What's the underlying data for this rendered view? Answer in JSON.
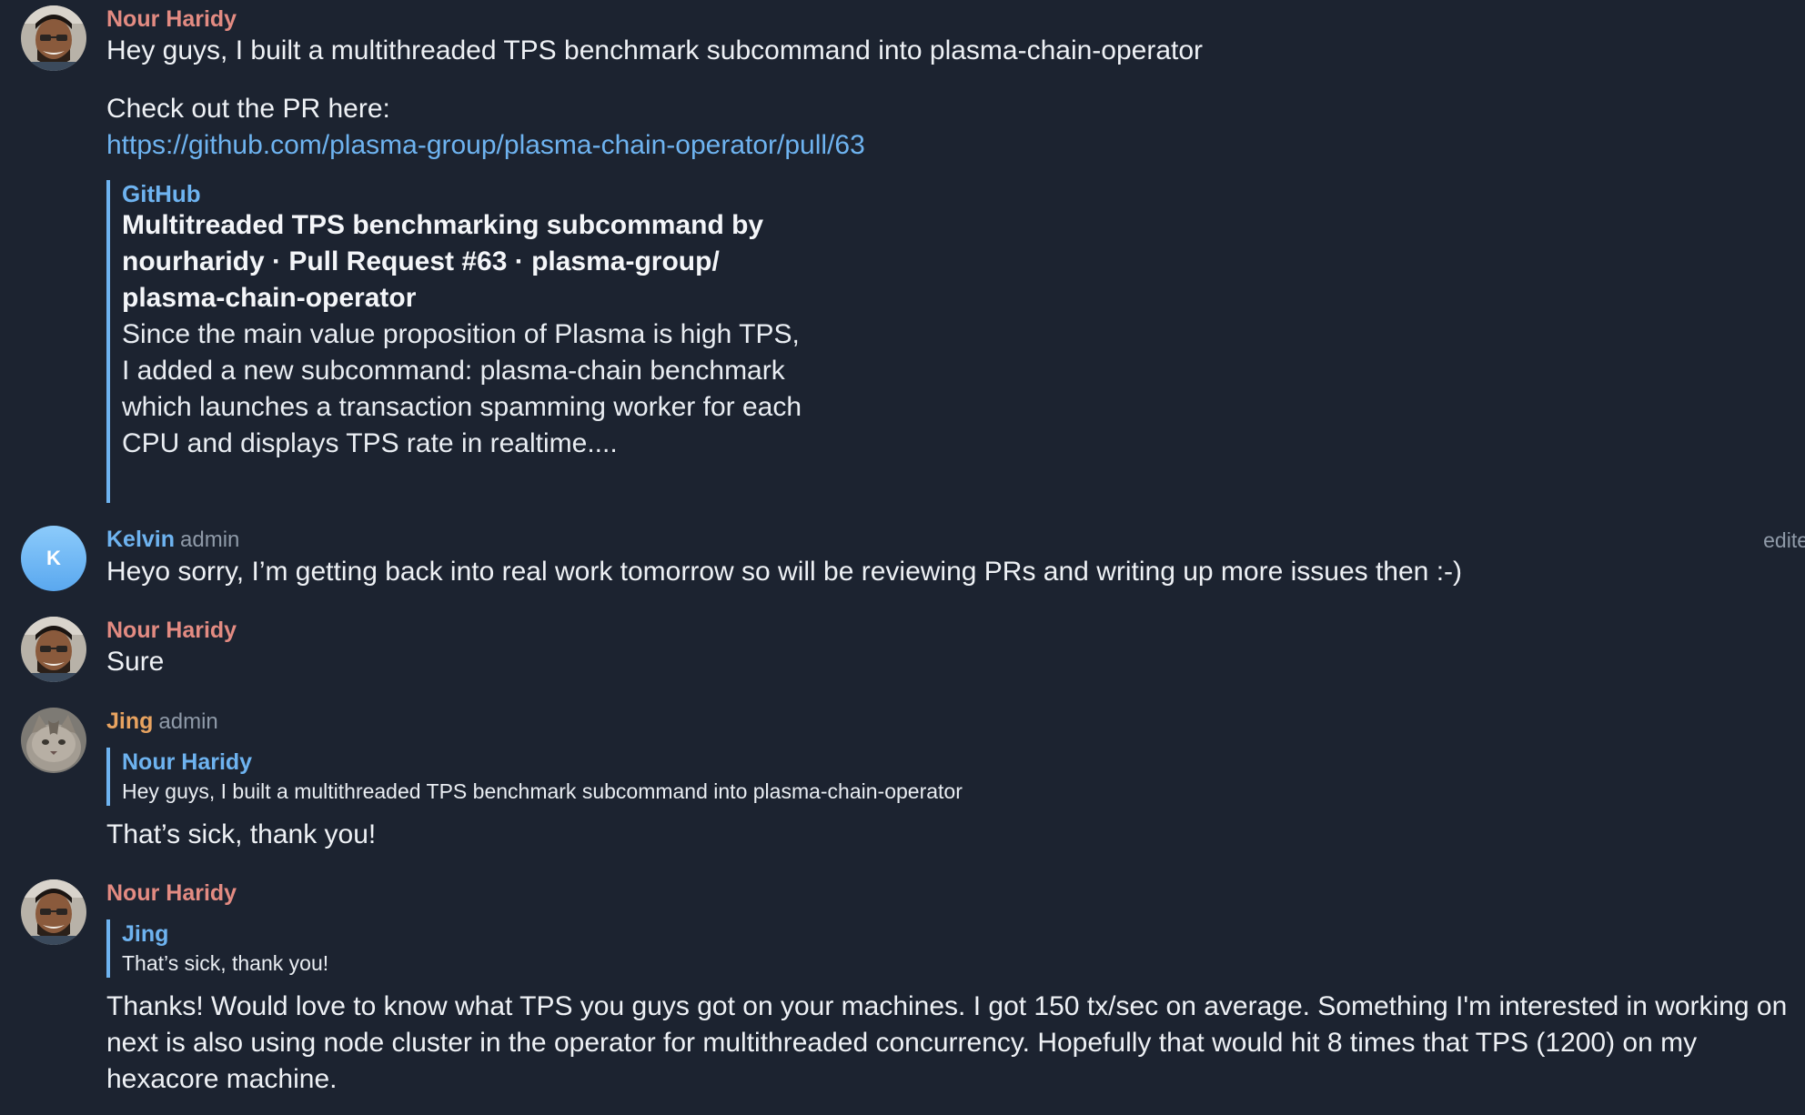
{
  "messages": [
    {
      "sender": "Nour Haridy",
      "text": "Hey guys, I built a multithreaded TPS benchmark subcommand into plasma-chain-operator",
      "text2": "Check out the PR here:",
      "link": "https://github.com/plasma-group/plasma-chain-operator/pull/63",
      "preview": {
        "site": "GitHub",
        "title": "Multitreaded TPS benchmarking subcommand by nourharidy · Pull Request #63 · plasma-group/ plasma-chain-operator",
        "description": "Since the main value proposition of Plasma is high TPS, I added a new subcommand: plasma-chain benchmark which launches a transaction spamming worker for each CPU and displays TPS rate in realtime...."
      }
    },
    {
      "sender": "Kelvin",
      "role": "admin",
      "avatar_letter": "K",
      "text": "Heyo sorry, I’m getting back into real work tomorrow so will be reviewing PRs and writing up more issues then :-)",
      "edited": "edite"
    },
    {
      "sender": "Nour Haridy",
      "text": "Sure"
    },
    {
      "sender": "Jing",
      "role": "admin",
      "reply": {
        "name": "Nour Haridy",
        "text": "Hey guys, I built a multithreaded TPS benchmark subcommand into plasma-chain-operator"
      },
      "text": "That’s sick, thank you!"
    },
    {
      "sender": "Nour Haridy",
      "reply": {
        "name": "Jing",
        "text": "That’s sick, thank you!"
      },
      "text": "Thanks! Would love to know what TPS you guys got on your machines. I got 150 tx/sec on average. Something I'm interested in working on next is also using node cluster in the operator for multithreaded concurrency. Hopefully that would hit 8 times that TPS (1200) on my hexacore machine."
    }
  ],
  "colors": {
    "background": "#1c2330",
    "nour_name": "#e38b82",
    "kelvin_name": "#6eb3f0",
    "jing_name": "#e8a360",
    "link": "#6eb3f0",
    "quote_bar": "#6eb3f0"
  }
}
